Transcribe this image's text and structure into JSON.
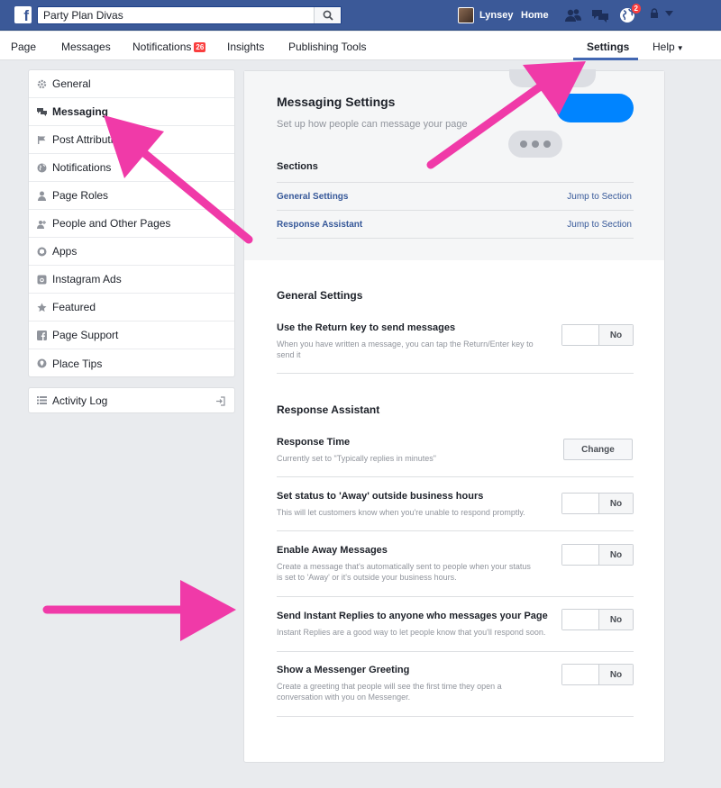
{
  "topbar": {
    "search_value": "Party Plan Divas",
    "user_name": "Lynsey",
    "home": "Home",
    "globe_badge": "2"
  },
  "pagenav": {
    "page": "Page",
    "messages": "Messages",
    "notifications": "Notifications",
    "notifications_badge": "26",
    "insights": "Insights",
    "publishing_tools": "Publishing Tools",
    "settings": "Settings",
    "help": "Help"
  },
  "sidebar": {
    "items": [
      {
        "label": "General",
        "icon": "gear-icon"
      },
      {
        "label": "Messaging",
        "icon": "chat-icon"
      },
      {
        "label": "Post Attribution",
        "icon": "flag-icon"
      },
      {
        "label": "Notifications",
        "icon": "globe-icon"
      },
      {
        "label": "Page Roles",
        "icon": "person-icon"
      },
      {
        "label": "People and Other Pages",
        "icon": "people-icon"
      },
      {
        "label": "Apps",
        "icon": "cube-icon"
      },
      {
        "label": "Instagram Ads",
        "icon": "camera-icon"
      },
      {
        "label": "Featured",
        "icon": "star-icon"
      },
      {
        "label": "Page Support",
        "icon": "facebook-icon"
      },
      {
        "label": "Place Tips",
        "icon": "location-icon"
      }
    ],
    "activity_log": "Activity Log"
  },
  "main": {
    "title": "Messaging Settings",
    "subtitle": "Set up how people can message your page",
    "sections_heading": "Sections",
    "sections": [
      {
        "name": "General Settings",
        "jump": "Jump to Section"
      },
      {
        "name": "Response Assistant",
        "jump": "Jump to Section"
      }
    ],
    "general_title": "General Settings",
    "general": {
      "return_key": {
        "label": "Use the Return key to send messages",
        "desc": "When you have written a message, you can tap the Return/Enter key to send it",
        "value": "No"
      }
    },
    "response_title": "Response Assistant",
    "response": {
      "response_time": {
        "label": "Response Time",
        "desc": "Currently set to \"Typically replies in minutes\"",
        "button": "Change"
      },
      "away_status": {
        "label": "Set status to 'Away' outside business hours",
        "desc": "This will let customers know when you're unable to respond promptly.",
        "value": "No"
      },
      "away_messages": {
        "label": "Enable Away Messages",
        "desc": "Create a message that's automatically sent to people when your status is set to 'Away' or it's outside your business hours.",
        "value": "No"
      },
      "instant_replies": {
        "label": "Send Instant Replies to anyone who messages your Page",
        "desc": "Instant Replies are a good way to let people know that you'll respond soon.",
        "value": "No"
      },
      "greeting": {
        "label": "Show a Messenger Greeting",
        "desc": "Create a greeting that people will see the first time they open a conversation with you on Messenger.",
        "value": "No"
      }
    }
  },
  "colors": {
    "facebook_blue": "#3b5998",
    "link_blue": "#365899",
    "messenger_blue": "#0084ff",
    "annotation_pink": "#f03aa8"
  }
}
